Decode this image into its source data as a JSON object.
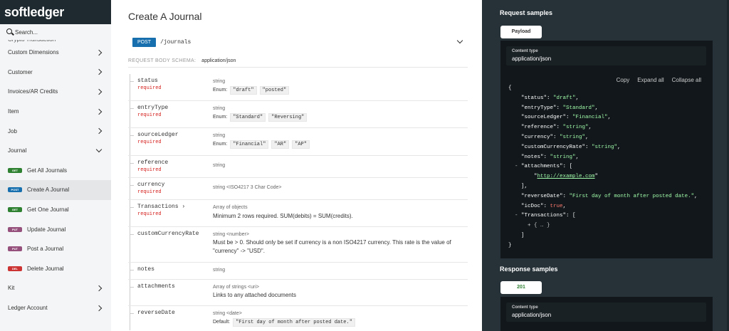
{
  "sidebar": {
    "logo": "softledger",
    "search_label": "Search...",
    "cut_item": "Crypto Transaction",
    "items": [
      {
        "label": "Custom Dimensions"
      },
      {
        "label": "Customer"
      },
      {
        "label": "Invoices/AR Credits"
      },
      {
        "label": "Item"
      },
      {
        "label": "Job"
      },
      {
        "label": "Journal"
      }
    ],
    "journal_subitems": [
      {
        "method": "GET",
        "label": "Get All Journals"
      },
      {
        "method": "POST",
        "label": "Create A Journal"
      },
      {
        "method": "GET",
        "label": "Get One Journal"
      },
      {
        "method": "PUT",
        "label": "Update Journal"
      },
      {
        "method": "PUT",
        "label": "Post a Journal"
      },
      {
        "method": "DEL",
        "label": "Delete Journal"
      }
    ],
    "bottom_items": [
      {
        "label": "Kit"
      },
      {
        "label": "Ledger Account"
      }
    ]
  },
  "main": {
    "title": "Create A Journal",
    "method": "POST",
    "path": "/journals",
    "schema_label": "REQUEST BODY SCHEMA:",
    "schema_type": "application/json",
    "fields": [
      {
        "name": "status",
        "required": "required",
        "type": "string",
        "enum_label": "Enum:",
        "enum": [
          "\"draft\"",
          "\"posted\""
        ]
      },
      {
        "name": "entryType",
        "required": "required",
        "type": "string",
        "enum_label": "Enum:",
        "enum": [
          "\"Standard\"",
          "\"Reversing\""
        ]
      },
      {
        "name": "sourceLedger",
        "required": "required",
        "type": "string",
        "enum_label": "Enum:",
        "enum": [
          "\"Financial\"",
          "\"AR\"",
          "\"AP\""
        ]
      },
      {
        "name": "reference",
        "required": "required",
        "type": "string"
      },
      {
        "name": "currency",
        "required": "required",
        "type": "string <ISO4217 3 Char Code>"
      },
      {
        "name": "Transactions ›",
        "required": "required",
        "type": "Array of objects",
        "desc": "Minimum 2 rows required. SUM(debits) = SUM(credits)."
      },
      {
        "name": "customCurrencyRate",
        "type": "string <number>",
        "desc": "Must be > 0. Should only be set if currency is a non ISO4217 currency. This rate is the value of \"currency\" -> \"USD\"."
      },
      {
        "name": "notes",
        "type": "string"
      },
      {
        "name": "attachments",
        "type": "Array of strings <uri>",
        "desc": "Links to any attached documents"
      },
      {
        "name": "reverseDate",
        "type": "string <date>",
        "default_label": "Default:",
        "default_val": "\"First day of month after posted date.\""
      }
    ]
  },
  "right_panel": {
    "request_title": "Request samples",
    "payload_tab": "Payload",
    "content_type_label": "Content type",
    "content_type_value": "application/json",
    "actions": [
      "Copy",
      "Expand all",
      "Collapse all"
    ],
    "json": {
      "open": "{",
      "close": "}",
      "status_key": "\"status\"",
      "status_val": "\"draft\"",
      "entryType_key": "\"entryType\"",
      "entryType_val": "\"Standard\"",
      "sourceLedger_key": "\"sourceLedger\"",
      "sourceLedger_val": "\"Financial\"",
      "reference_key": "\"reference\"",
      "reference_val": "\"string\"",
      "currency_key": "\"currency\"",
      "currency_val": "\"string\"",
      "ccr_key": "\"customCurrencyRate\"",
      "ccr_val": "\"string\"",
      "notes_key": "\"notes\"",
      "notes_val": "\"string\"",
      "attachments_key": "\"attachments\"",
      "attachments_url": "http://example.com",
      "reverseDate_key": "\"reverseDate\"",
      "reverseDate_val": "\"First day of month after posted date.\"",
      "icDoc_key": "\"icDoc\"",
      "icDoc_val": "true",
      "transactions_key": "\"Transactions\"",
      "collapsed": "+ { … }"
    },
    "response_title": "Response samples",
    "response_tab": "201",
    "response_ct_label": "Content type",
    "response_ct_value": "application/json"
  }
}
